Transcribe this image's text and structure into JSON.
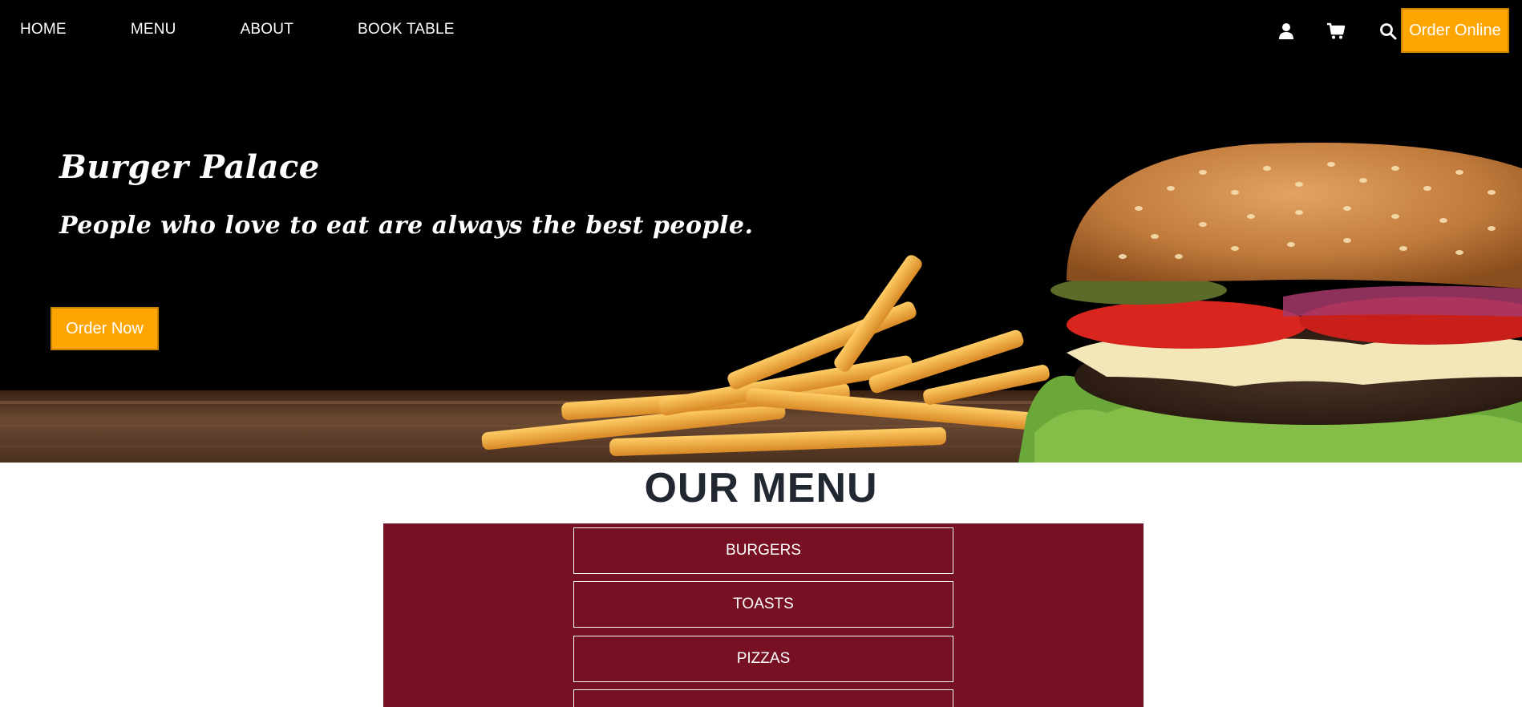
{
  "nav": {
    "links": [
      "HOME",
      "MENU",
      "ABOUT",
      "BOOK TABLE"
    ],
    "icons": [
      "user-icon",
      "cart-icon",
      "search-icon"
    ],
    "order_online": "Order Online"
  },
  "hero": {
    "title": "Burger Palace",
    "subtitle": "People who love to eat are always the best people.",
    "cta": "Order Now"
  },
  "menu": {
    "heading": "OUR MENU",
    "categories": [
      "BURGERS",
      "TOASTS",
      "PIZZAS",
      ""
    ]
  },
  "colors": {
    "accent": "#ffa500",
    "menu_panel": "#761022",
    "hero_bg": "#000000",
    "heading_text": "#222831"
  }
}
